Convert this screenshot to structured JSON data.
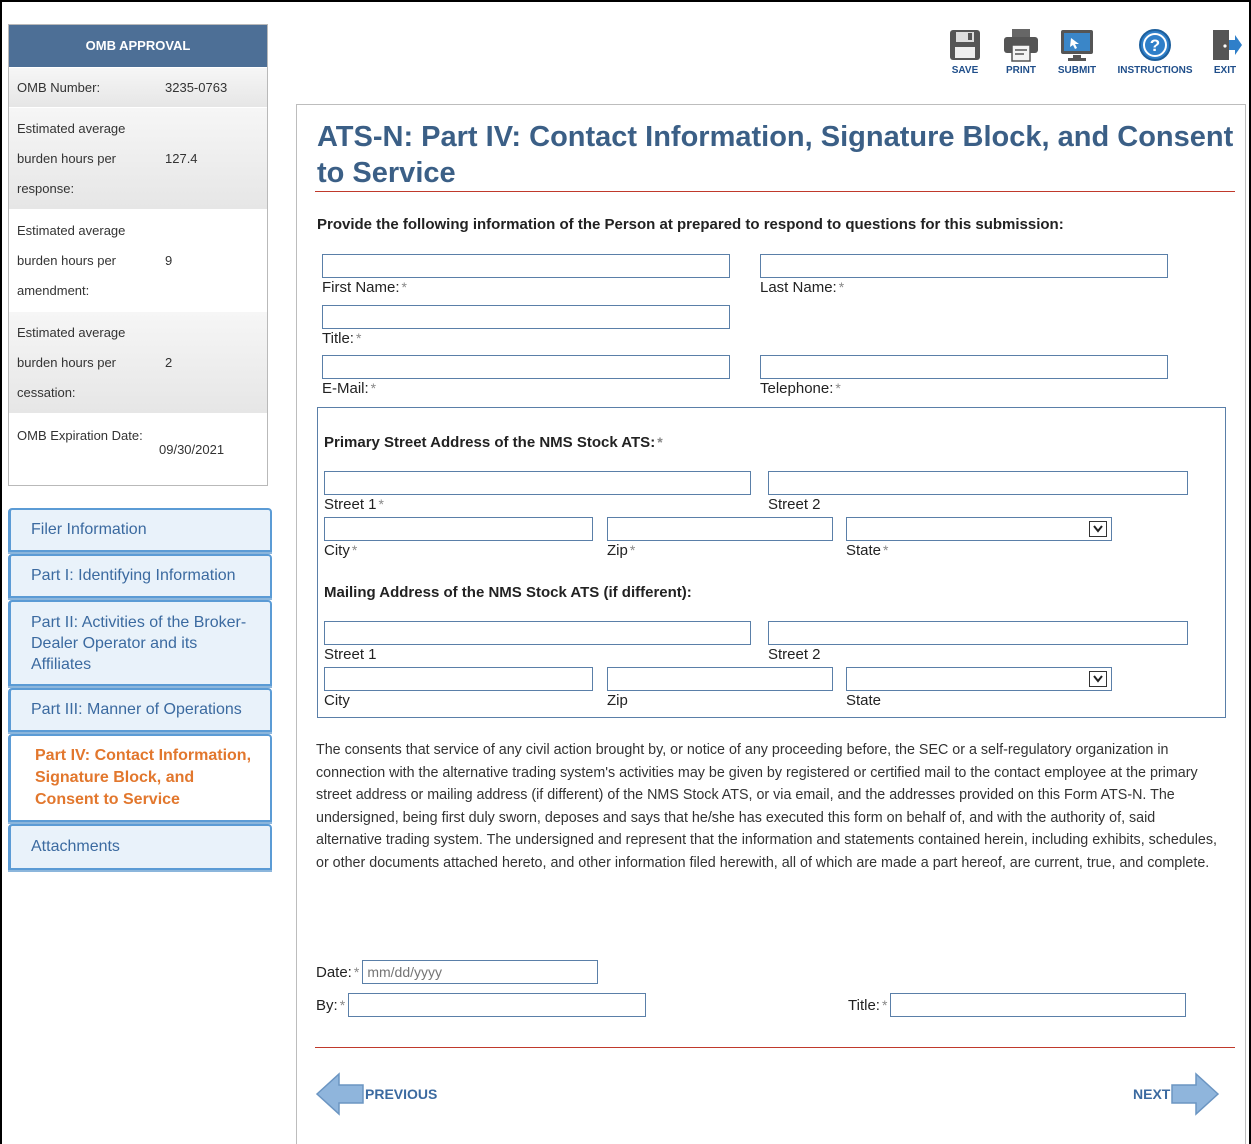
{
  "omb": {
    "header": "OMB APPROVAL",
    "rows": [
      {
        "label": "OMB Number:",
        "value": "3235-0763"
      },
      {
        "label": "Estimated average burden hours per response:",
        "value": "127.4"
      },
      {
        "label": "Estimated average burden hours per amendment:",
        "value": "9"
      },
      {
        "label": "Estimated average burden hours per cessation:",
        "value": "2"
      },
      {
        "label": "OMB Expiration Date:",
        "value": "09/30/2021"
      }
    ]
  },
  "nav": {
    "items": [
      {
        "label": "Filer Information"
      },
      {
        "label": "Part I: Identifying Information"
      },
      {
        "label": "Part II: Activities of the Broker-Dealer Operator and its Affiliates"
      },
      {
        "label": "Part III: Manner of Operations"
      },
      {
        "label": "Part IV: Contact Information, Signature Block, and Consent to Service",
        "active": true
      },
      {
        "label": "Attachments"
      }
    ]
  },
  "toolbar": {
    "save": "SAVE",
    "print": "PRINT",
    "submit": "SUBMIT",
    "instructions": "INSTRUCTIONS",
    "exit": "EXIT"
  },
  "page": {
    "title": "ATS-N: Part IV: Contact Information, Signature Block, and Consent to Service",
    "lead": "Provide the following information of the Person at prepared to respond to questions for this submission:"
  },
  "contact": {
    "first_name": {
      "label": "First Name:",
      "value": ""
    },
    "last_name": {
      "label": "Last Name:",
      "value": ""
    },
    "title": {
      "label": "Title:",
      "value": ""
    },
    "email": {
      "label": "E-Mail:",
      "value": ""
    },
    "telephone": {
      "label": "Telephone:",
      "value": ""
    }
  },
  "primary_address": {
    "heading": "Primary Street Address of the NMS Stock ATS:",
    "street1": "Street 1",
    "street2": "Street 2",
    "city": "City",
    "zip": "Zip",
    "state": "State"
  },
  "mailing_address": {
    "heading": "Mailing Address of the NMS Stock ATS (if different):",
    "street1": "Street 1",
    "street2": "Street 2",
    "city": "City",
    "zip": "Zip",
    "state": "State"
  },
  "consent_text": "The consents that service of any civil action brought by, or notice of any proceeding before, the SEC or a self-regulatory organization in connection with the alternative trading system's activities may be given by registered or certified mail to the contact employee at the primary street address or mailing address (if different) of the NMS Stock ATS, or via email, and the addresses provided on this Form ATS-N. The undersigned, being first duly sworn, deposes and says that he/she has executed this form on behalf of, and with the authority of, said alternative trading system. The undersigned and represent that the information and statements contained herein, including exhibits, schedules, or other documents attached hereto, and other information filed herewith, all of which are made a part hereof, are current, true, and complete.",
  "signature": {
    "date_label": "Date:",
    "date_placeholder": "mm/dd/yyyy",
    "by_label": "By:",
    "title_label": "Title:"
  },
  "required_mark": "*",
  "pager": {
    "previous": "PREVIOUS",
    "next": "NEXT"
  },
  "colors": {
    "brand_blue": "#4d6f96",
    "title_blue": "#3b5f86",
    "active_orange": "#e2772d",
    "rule_red": "#c0392b"
  }
}
